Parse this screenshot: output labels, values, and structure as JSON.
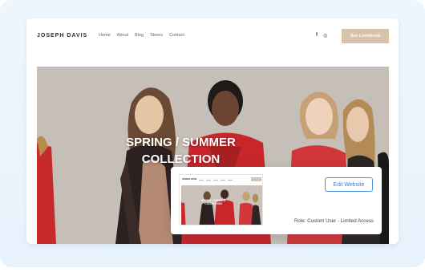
{
  "site": {
    "brand": "JOSEPH DAVIS",
    "menu": [
      {
        "label": "Home"
      },
      {
        "label": "About"
      },
      {
        "label": "Blog"
      },
      {
        "label": "Stores"
      },
      {
        "label": "Contact"
      }
    ],
    "social": {
      "facebook": "f",
      "instagram": "◎"
    },
    "cta_label": "See Lookbook"
  },
  "hero": {
    "title_line1": "SPRING / SUMMER",
    "title_line2": "COLLECTION"
  },
  "access_card": {
    "preview_brand": "JOSEPH DAVIS",
    "preview_title_line1": "SPRING / SUMMER",
    "preview_title_line2": "COLLECTION",
    "edit_label": "Edit Website",
    "role_text": "Role: Custom User - Limited Access"
  },
  "colors": {
    "accent_tan": "#d7c2ad",
    "edit_blue": "#3a7fd5",
    "background": "#eaf4fd"
  }
}
